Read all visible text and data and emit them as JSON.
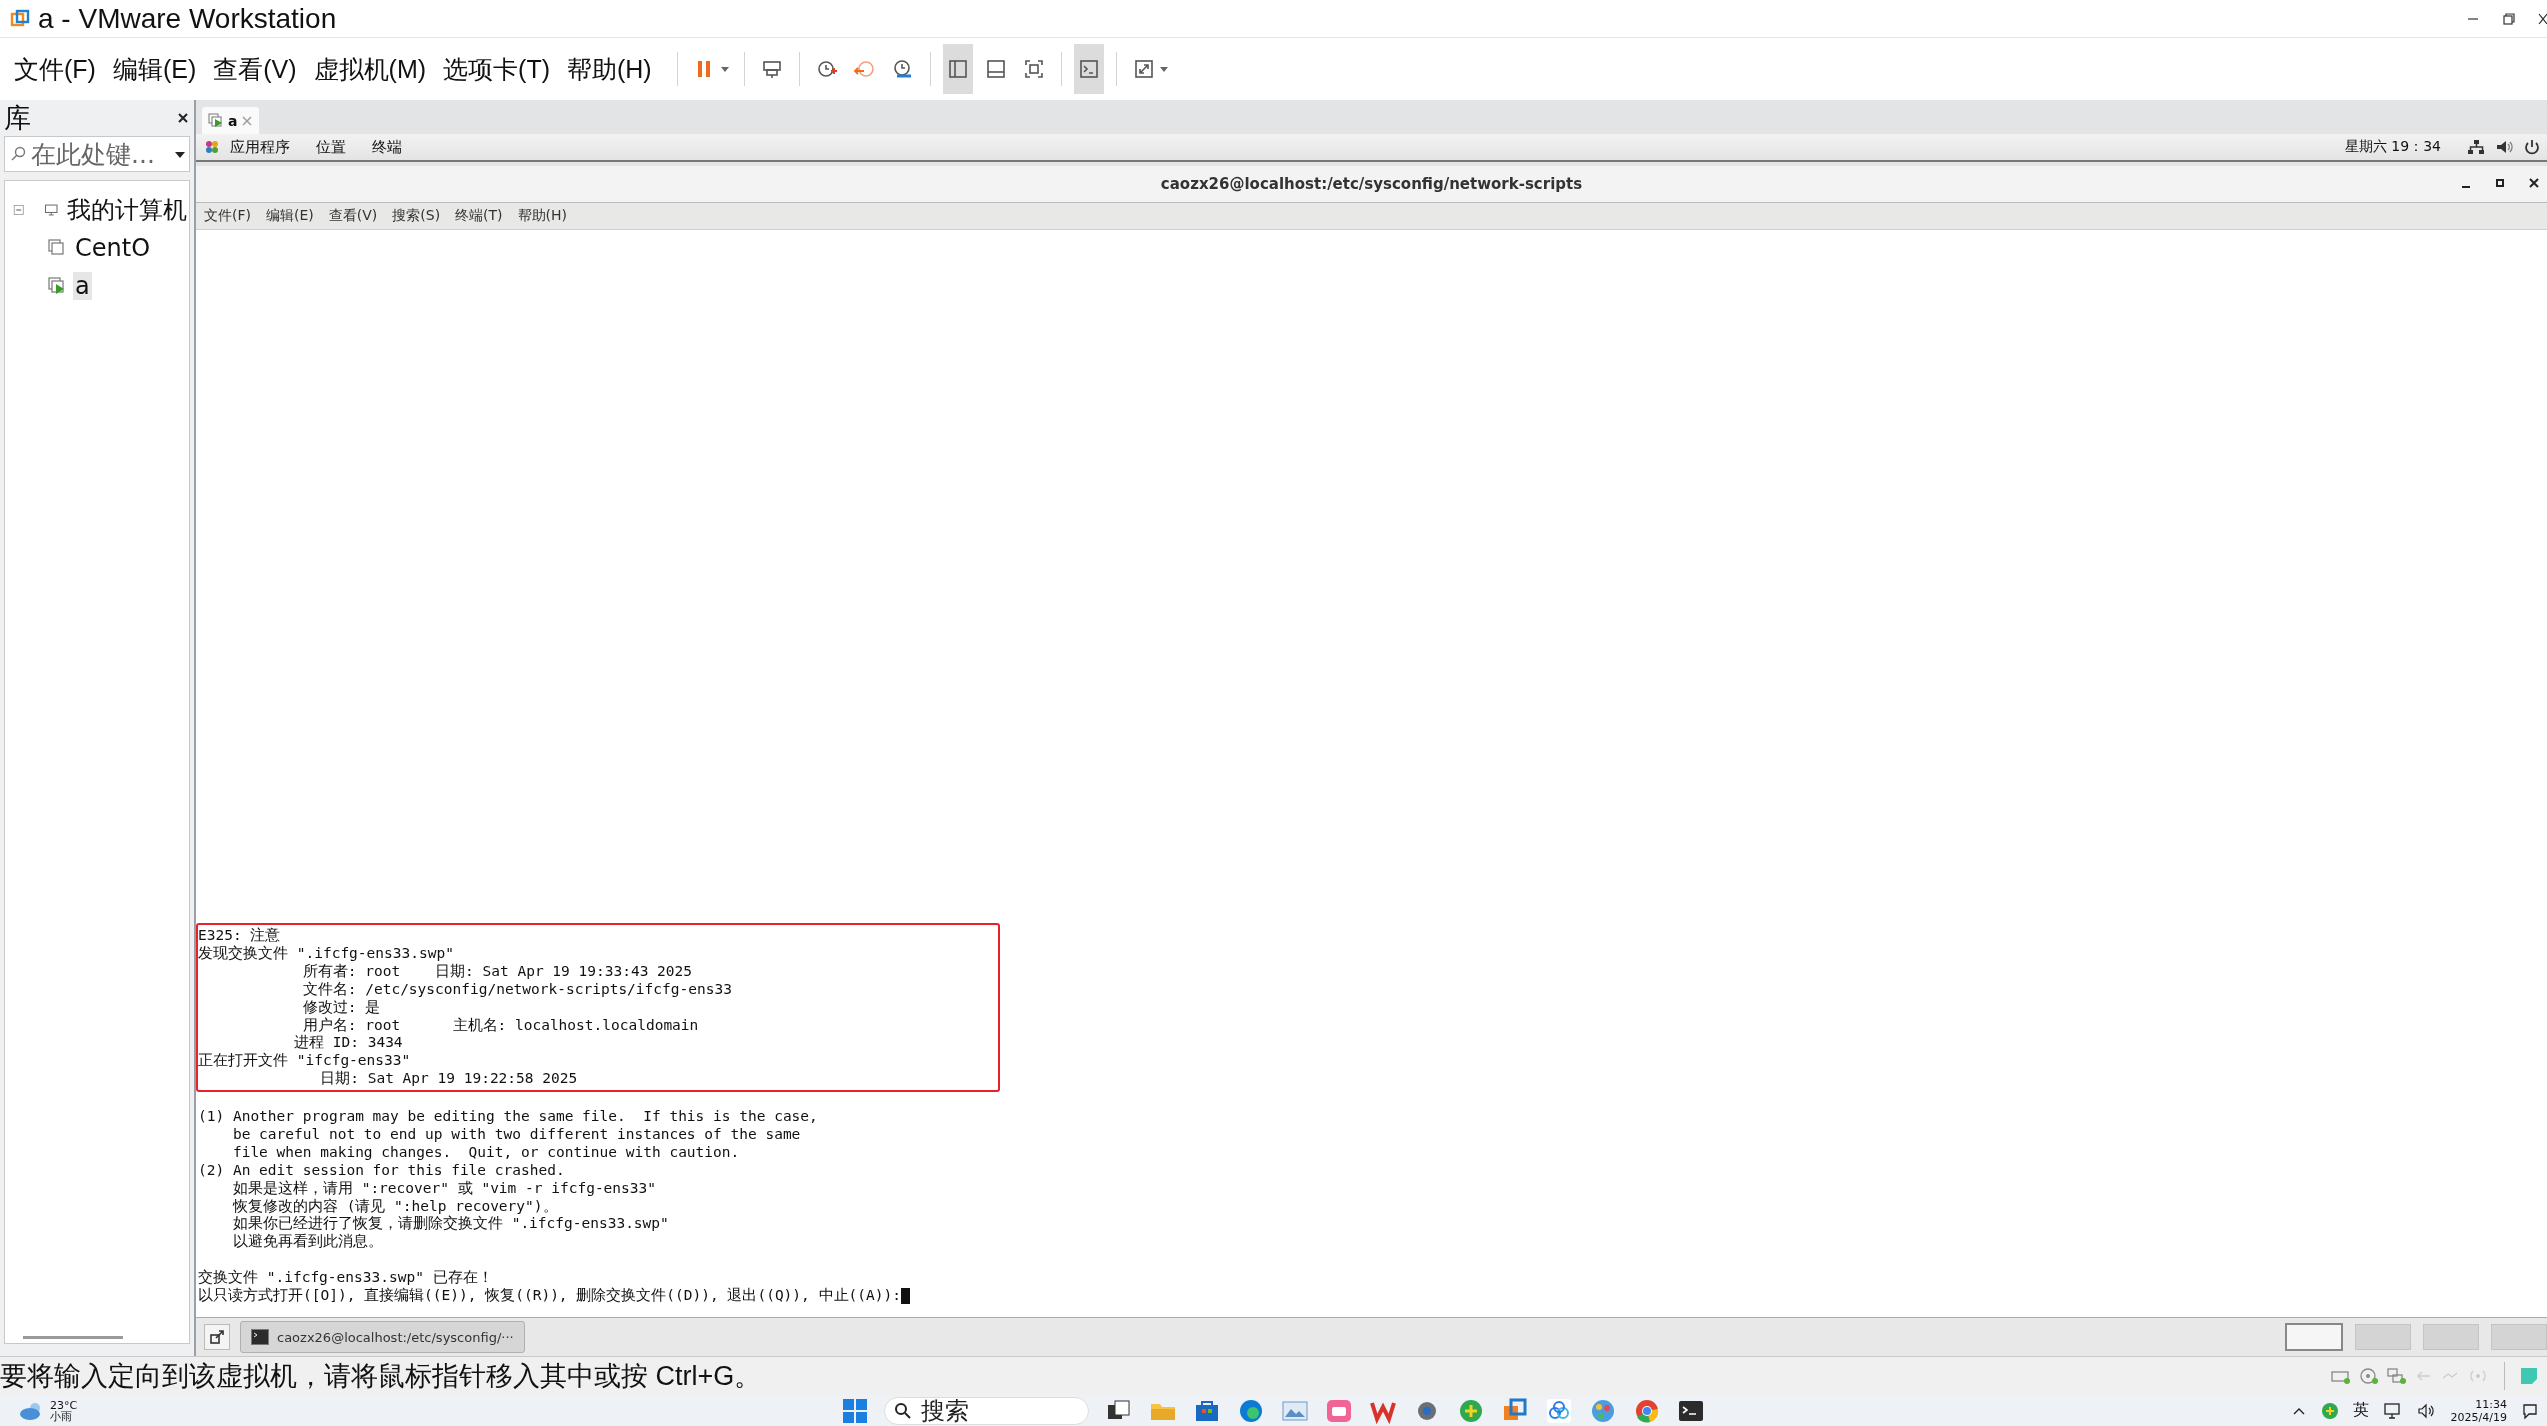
{
  "window": {
    "title": "a - VMware Workstation"
  },
  "menu": [
    "文件(F)",
    "编辑(E)",
    "查看(V)",
    "虚拟机(M)",
    "选项卡(T)",
    "帮助(H)"
  ],
  "toolbar": [
    {
      "kind": "pause",
      "pressed": false,
      "sep": true,
      "dropdown": true
    },
    {
      "kind": "ctrl-alt-del",
      "pressed": false,
      "sep": true,
      "dropdown": false
    },
    {
      "kind": "snapshot",
      "pressed": false,
      "sep": true,
      "dropdown": false
    },
    {
      "kind": "revert",
      "pressed": false,
      "sep": false,
      "dropdown": false
    },
    {
      "kind": "manager",
      "pressed": false,
      "sep": false,
      "dropdown": false
    },
    {
      "kind": "library",
      "pressed": true,
      "sep": true,
      "dropdown": false
    },
    {
      "kind": "thumbnails",
      "pressed": false,
      "sep": false,
      "dropdown": false
    },
    {
      "kind": "fullscreen",
      "pressed": false,
      "sep": false,
      "dropdown": false
    },
    {
      "kind": "console",
      "pressed": true,
      "sep": true,
      "dropdown": false
    },
    {
      "kind": "stretch",
      "pressed": false,
      "sep": true,
      "dropdown": true
    }
  ],
  "library": {
    "title": "库",
    "search": {
      "placeholder": "在此处键..."
    },
    "tree": [
      {
        "label": "我的计算机",
        "expanded": true,
        "selected": false,
        "kind": "computer",
        "children": [
          {
            "label": "CentO",
            "selected": false,
            "kind": "vm",
            "running": false
          },
          {
            "label": "a",
            "selected": true,
            "kind": "vm",
            "running": true
          }
        ]
      }
    ]
  },
  "tabs": [
    {
      "label": "a",
      "selected": true,
      "running": true
    }
  ],
  "guest": {
    "top_bar": {
      "menus": [
        "应用程序",
        "位置",
        "终端"
      ],
      "clock": "星期六 19：34"
    },
    "terminal": {
      "title": "caozx26@localhost:/etc/sysconfig/network-scripts",
      "menu": [
        "文件(F)",
        "编辑(E)",
        "查看(V)",
        "搜索(S)",
        "终端(T)",
        "帮助(H)"
      ],
      "highlighted_lines": [
        "E325: 注意",
        "发现交换文件 \".ifcfg-ens33.swp\"",
        "            所有者: root    日期: Sat Apr 19 19:33:43 2025",
        "            文件名: /etc/sysconfig/network-scripts/ifcfg-ens33",
        "            修改过: 是",
        "            用户名: root      主机名: localhost.localdomain",
        "           进程 ID: 3434",
        "正在打开文件 \"ifcfg-ens33\"",
        "              日期: Sat Apr 19 19:22:58 2025"
      ],
      "notice_lines": [
        "(1) Another program may be editing the same file.  If this is the case,",
        "    be careful not to end up with two different instances of the same",
        "    file when making changes.  Quit, or continue with caution.",
        "(2) An edit session for this file crashed.",
        "    如果是这样，请用 \":recover\" 或 \"vim -r ifcfg-ens33\"",
        "    恢复修改的内容 (请见 \":help recovery\")。",
        "    如果你已经进行了恢复，请删除交换文件 \".ifcfg-ens33.swp\"",
        "    以避免再看到此消息。"
      ],
      "prompt_lines": [
        "交换文件 \".ifcfg-ens33.swp\" 已存在！",
        "以只读方式打开([O]), 直接编辑((E)), 恢复((R)), 删除交换文件((D)), 退出((Q)), 中止((A)):"
      ]
    },
    "taskbar": {
      "task": "caozx26@localhost:/etc/sysconfig/···",
      "workspaces": [
        {
          "selected": true
        },
        {
          "selected": false
        },
        {
          "selected": false
        },
        {
          "selected": false
        }
      ]
    }
  },
  "status_bar": {
    "message": "要将输入定向到该虚拟机，请将鼠标指针移入其中或按 Ctrl+G。"
  },
  "taskbar": {
    "weather": {
      "temp": "23°C",
      "condition": "小雨"
    },
    "search": {
      "placeholder": "搜索"
    },
    "ime": "英",
    "time": "11:34",
    "date": "2025/4/19"
  }
}
